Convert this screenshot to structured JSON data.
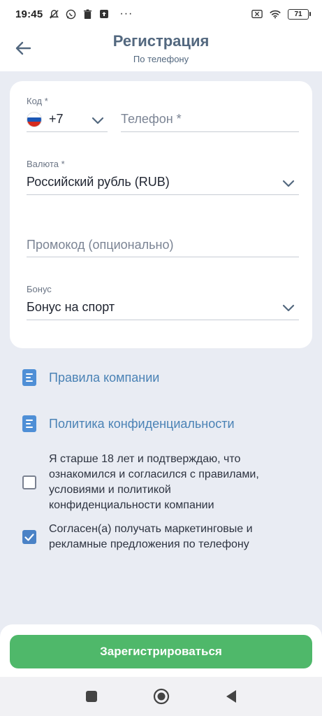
{
  "status_bar": {
    "time": "19:45",
    "battery": "71",
    "more": "···"
  },
  "header": {
    "title": "Регистрация",
    "subtitle": "По телефону"
  },
  "form": {
    "code": {
      "label": "Код *",
      "value": "+7",
      "flag": "russia-flag"
    },
    "phone": {
      "placeholder": "Телефон *"
    },
    "currency": {
      "label": "Валюта *",
      "value": "Российский рубль (RUB)"
    },
    "promo": {
      "placeholder": "Промокод (опционально)"
    },
    "bonus": {
      "label": "Бонус",
      "value": "Бонус на спорт"
    }
  },
  "links": [
    {
      "label": "Правила компании",
      "icon": "document-icon"
    },
    {
      "label": "Политика конфиденциальности",
      "icon": "document-icon"
    }
  ],
  "checkboxes": [
    {
      "text": "Я старше 18 лет и подтверждаю, что ознакомился и согласился с правилами, условиями и политикой конфиденциальности компании",
      "checked": false
    },
    {
      "text": "Согласен(а) получать маркетинговые и рекламные предложения по телефону",
      "checked": true
    }
  ],
  "register_button": {
    "label": "Зарегистрироваться"
  },
  "colors": {
    "accent_green": "#4fb86a",
    "link_blue": "#4a82b5",
    "title": "#53687f",
    "background": "#e9ecf3"
  }
}
